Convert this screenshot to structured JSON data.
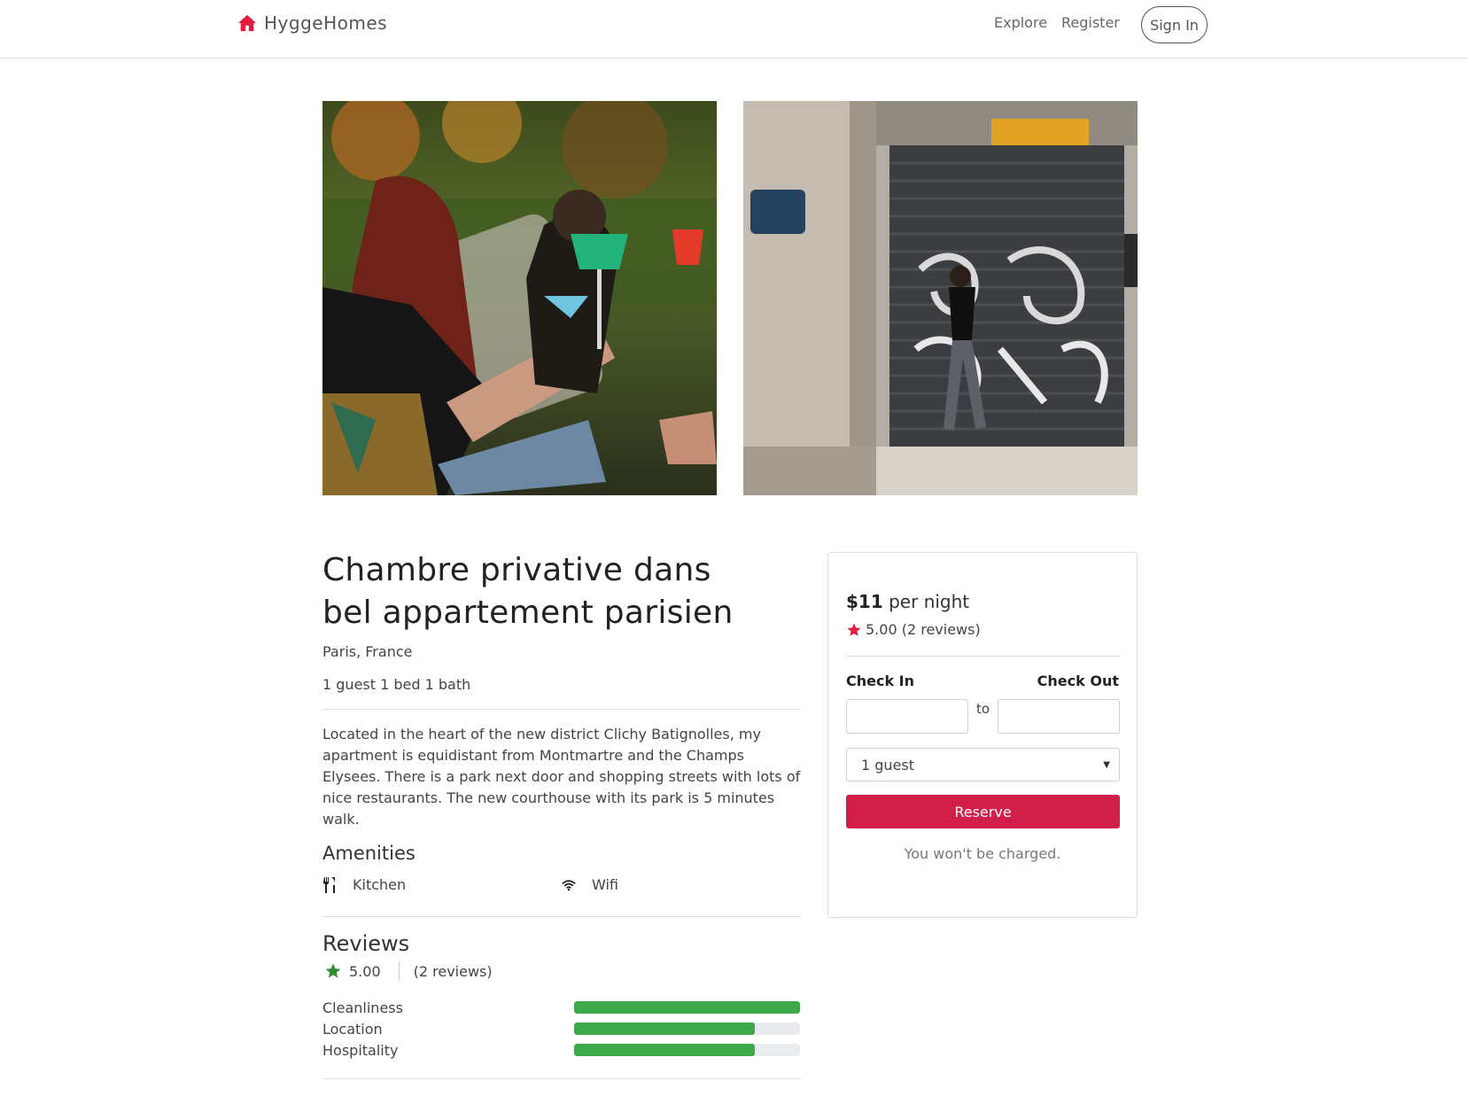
{
  "navbar": {
    "brand": "HyggeHomes",
    "explore": "Explore",
    "register": "Register",
    "sign_in": "Sign In",
    "brand_color": "#e31c3d"
  },
  "photos": [
    {
      "icon": "photo-party-drinks"
    },
    {
      "icon": "photo-street-graffiti"
    }
  ],
  "listing": {
    "title_line1": "Chambre privative dans",
    "title_line2": "bel appartement parisien",
    "location": "Paris, France",
    "guests": "1 guest",
    "beds": "1 bed",
    "baths": "1 bath",
    "description": "Located in the heart of the new district Clichy Batignolles, my apartment is equidistant from Montmartre and the Champs Elysees. There is a park next door and shopping streets with lots of nice restaurants. The new courthouse with its park is 5 minutes walk."
  },
  "amenities": {
    "title": "Amenities",
    "items": [
      {
        "label": "Kitchen",
        "icon": "utensils-icon"
      },
      {
        "label": "Wifi",
        "icon": "wifi-icon"
      }
    ]
  },
  "reviews": {
    "title": "Reviews",
    "score": "5.00",
    "count": "(2 reviews)",
    "star_color": "#2e8b2e",
    "bar_color": "#3fa94a",
    "categories": [
      {
        "label": "Cleanliness",
        "fraction": 1.0
      },
      {
        "label": "Location",
        "fraction": 0.8
      },
      {
        "label": "Hospitality",
        "fraction": 0.8
      }
    ]
  },
  "booking": {
    "price": "$11",
    "per_night": "per night",
    "rating": "5.00 (2 reviews)",
    "star_color": "#e31c3d",
    "check_in_label": "Check In",
    "check_out_label": "Check Out",
    "check_in_value": "",
    "check_out_value": "",
    "to_label": "to",
    "guests_selected": "1 guest",
    "reserve_label": "Reserve",
    "reserve_color": "#d21f4a",
    "note": "You won't be charged."
  }
}
